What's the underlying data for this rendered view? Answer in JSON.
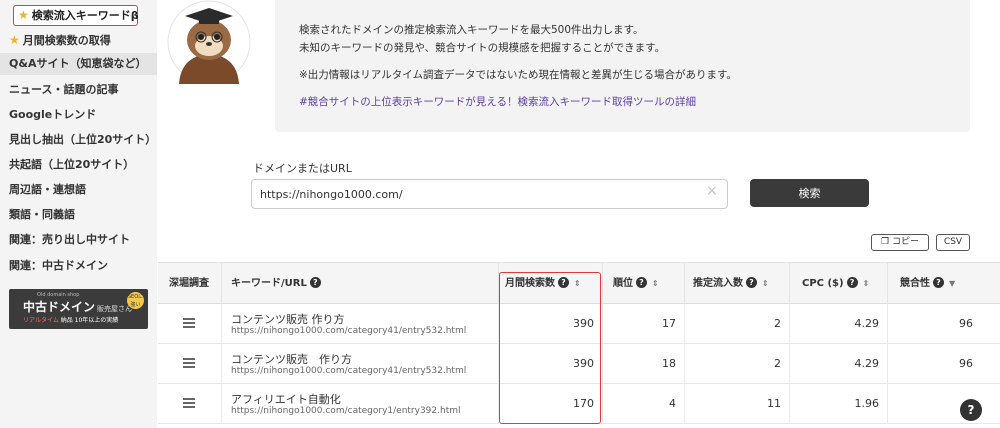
{
  "sidebar": {
    "items": [
      {
        "label": "検索流入キーワードβ"
      },
      {
        "label": "月間検索数の取得"
      },
      {
        "label": "Q&Aサイト（知恵袋など）"
      },
      {
        "label": "ニュース・話題の記事"
      },
      {
        "label": "Googleトレンド"
      },
      {
        "label": "見出し抽出（上位20サイト）"
      },
      {
        "label": "共起語（上位20サイト）"
      },
      {
        "label": "周辺語・連想語"
      },
      {
        "label": "類語・同義語"
      },
      {
        "label": "関連：売り出し中サイト"
      },
      {
        "label": "関連：中古ドメイン"
      }
    ],
    "banner": {
      "small": "Old domain shop",
      "main": "中古ドメイン",
      "main_suffix": "販売屋さん",
      "sub_highlight": "リアルタイム",
      "sub_rest": "納品 10年以上の実績",
      "badge": "SEOに強い"
    }
  },
  "info": {
    "line1": "検索されたドメインの推定検索流入キーワードを最大500件出力します。",
    "line2": "未知のキーワードの発見や、競合サイトの規模感を把握することができます。",
    "line3": "※出力情報はリアルタイム調査データではないため現在情報と差異が生じる場合があります。",
    "link": "#競合サイトの上位表示キーワードが見える！検索流入キーワード取得ツールの詳細"
  },
  "form": {
    "label": "ドメインまたはURL",
    "value": "https://nihongo1000.com/",
    "clear": "×",
    "search_label": "検索"
  },
  "actions": {
    "copy_label": "コピー",
    "csv_label": "CSV"
  },
  "table": {
    "headers": {
      "deep": "深堀調査",
      "keyword": "キーワード/URL",
      "monthly": "月間検索数",
      "rank": "順位",
      "traffic": "推定流入数",
      "cpc": "CPC ($)",
      "competition": "競合性"
    },
    "rows": [
      {
        "keyword": "コンテンツ販売 作り方",
        "url": "https://nihongo1000.com/category41/entry532.html",
        "monthly": "390",
        "rank": "17",
        "traffic": "2",
        "cpc": "4.29",
        "competition": "96"
      },
      {
        "keyword": "コンテンツ販売　作り方",
        "url": "https://nihongo1000.com/category41/entry532.html",
        "monthly": "390",
        "rank": "18",
        "traffic": "2",
        "cpc": "4.29",
        "competition": "96"
      },
      {
        "keyword": "アフィリエイト自動化",
        "url": "https://nihongo1000.com/category1/entry392.html",
        "monthly": "170",
        "rank": "4",
        "traffic": "11",
        "cpc": "1.96",
        "competition": ""
      }
    ]
  },
  "help_label": "?",
  "colors": {
    "highlight": "#e03b3b",
    "link": "#5b3fa8",
    "button": "#3a3a3a",
    "star": "#f0b429"
  }
}
